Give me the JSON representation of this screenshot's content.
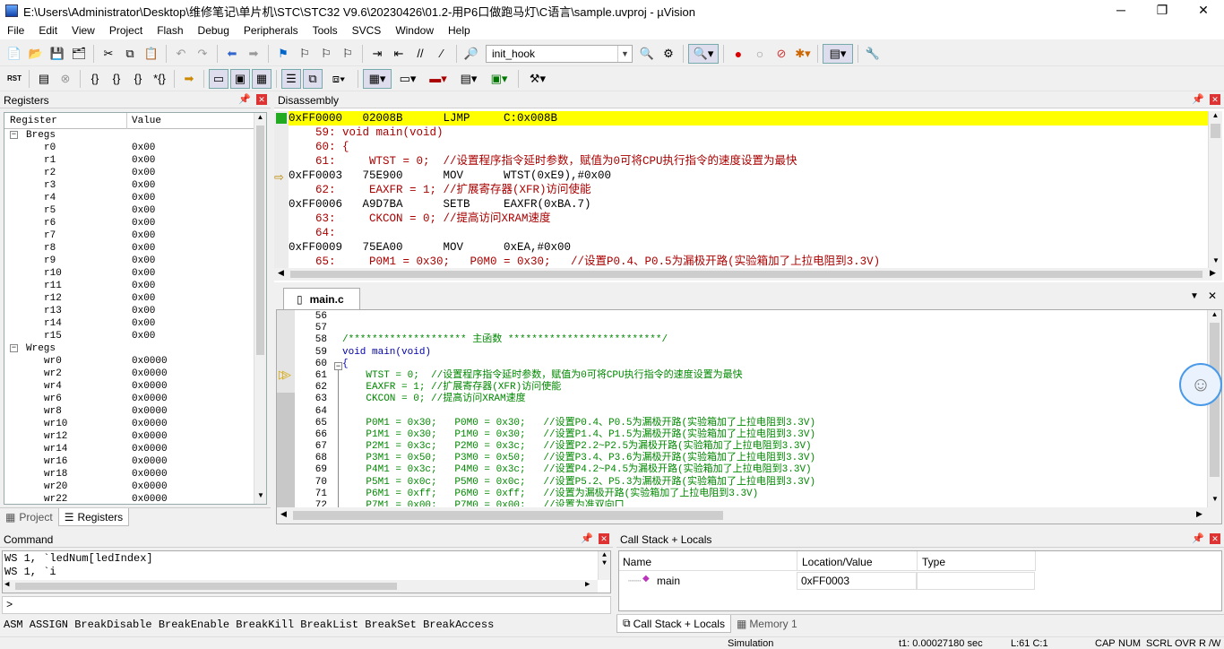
{
  "window": {
    "title": "E:\\Users\\Administrator\\Desktop\\维修笔记\\单片机\\STC\\STC32 V9.6\\20230426\\01.2-用P6口做跑马灯\\C语言\\sample.uvproj - µVision",
    "minimize": "─",
    "maximize": "❐",
    "close": "✕"
  },
  "menu": [
    "File",
    "Edit",
    "View",
    "Project",
    "Flash",
    "Debug",
    "Peripherals",
    "Tools",
    "SVCS",
    "Window",
    "Help"
  ],
  "toolbar": {
    "combo_value": "init_hook"
  },
  "registers": {
    "title": "Registers",
    "col_register": "Register",
    "col_value": "Value",
    "groups": [
      {
        "name": "Bregs",
        "items": [
          {
            "n": "r0",
            "v": "0x00"
          },
          {
            "n": "r1",
            "v": "0x00"
          },
          {
            "n": "r2",
            "v": "0x00"
          },
          {
            "n": "r3",
            "v": "0x00"
          },
          {
            "n": "r4",
            "v": "0x00"
          },
          {
            "n": "r5",
            "v": "0x00"
          },
          {
            "n": "r6",
            "v": "0x00"
          },
          {
            "n": "r7",
            "v": "0x00"
          },
          {
            "n": "r8",
            "v": "0x00"
          },
          {
            "n": "r9",
            "v": "0x00"
          },
          {
            "n": "r10",
            "v": "0x00"
          },
          {
            "n": "r11",
            "v": "0x00"
          },
          {
            "n": "r12",
            "v": "0x00"
          },
          {
            "n": "r13",
            "v": "0x00"
          },
          {
            "n": "r14",
            "v": "0x00"
          },
          {
            "n": "r15",
            "v": "0x00"
          }
        ]
      },
      {
        "name": "Wregs",
        "items": [
          {
            "n": "wr0",
            "v": "0x0000"
          },
          {
            "n": "wr2",
            "v": "0x0000"
          },
          {
            "n": "wr4",
            "v": "0x0000"
          },
          {
            "n": "wr6",
            "v": "0x0000"
          },
          {
            "n": "wr8",
            "v": "0x0000"
          },
          {
            "n": "wr10",
            "v": "0x0000"
          },
          {
            "n": "wr12",
            "v": "0x0000"
          },
          {
            "n": "wr14",
            "v": "0x0000"
          },
          {
            "n": "wr16",
            "v": "0x0000"
          },
          {
            "n": "wr18",
            "v": "0x0000"
          },
          {
            "n": "wr20",
            "v": "0x0000"
          },
          {
            "n": "wr22",
            "v": "0x0000"
          }
        ]
      }
    ],
    "tab_project": "Project",
    "tab_registers": "Registers"
  },
  "disassembly": {
    "title": "Disassembly",
    "lines": [
      "0xFF0000   02008B      LJMP     C:0x008B",
      "    59: void main(void)",
      "    60: {",
      "    61:     WTST = 0;  //设置程序指令延时参数，赋值为0可将CPU执行指令的速度设置为最快",
      "0xFF0003   75E900      MOV      WTST(0xE9),#0x00",
      "    62:     EAXFR = 1; //扩展寄存器(XFR)访问使能",
      "0xFF0006   A9D7BA      SETB     EAXFR(0xBA.7)",
      "    63:     CKCON = 0; //提高访问XRAM速度",
      "    64: ",
      "0xFF0009   75EA00      MOV      0xEA,#0x00",
      "    65:     P0M1 = 0x30;   P0M0 = 0x30;   //设置P0.4、P0.5为漏极开路(实验箱加了上拉电阻到3.3V)"
    ]
  },
  "editor": {
    "tab": "main.c",
    "lines": [
      {
        "ln": "56",
        "t": ""
      },
      {
        "ln": "57",
        "t": ""
      },
      {
        "ln": "58",
        "t": "/******************** 主函数 **************************/"
      },
      {
        "ln": "59",
        "t": "void main(void)"
      },
      {
        "ln": "60",
        "t": "{"
      },
      {
        "ln": "61",
        "t": "    WTST = 0;  //设置程序指令延时参数，赋值为0可将CPU执行指令的速度设置为最快"
      },
      {
        "ln": "62",
        "t": "    EAXFR = 1; //扩展寄存器(XFR)访问使能"
      },
      {
        "ln": "63",
        "t": "    CKCON = 0; //提高访问XRAM速度"
      },
      {
        "ln": "64",
        "t": ""
      },
      {
        "ln": "65",
        "t": "    P0M1 = 0x30;   P0M0 = 0x30;   //设置P0.4、P0.5为漏极开路(实验箱加了上拉电阻到3.3V)"
      },
      {
        "ln": "66",
        "t": "    P1M1 = 0x30;   P1M0 = 0x30;   //设置P1.4、P1.5为漏极开路(实验箱加了上拉电阻到3.3V)"
      },
      {
        "ln": "67",
        "t": "    P2M1 = 0x3c;   P2M0 = 0x3c;   //设置P2.2~P2.5为漏极开路(实验箱加了上拉电阻到3.3V)"
      },
      {
        "ln": "68",
        "t": "    P3M1 = 0x50;   P3M0 = 0x50;   //设置P3.4、P3.6为漏极开路(实验箱加了上拉电阻到3.3V)"
      },
      {
        "ln": "69",
        "t": "    P4M1 = 0x3c;   P4M0 = 0x3c;   //设置P4.2~P4.5为漏极开路(实验箱加了上拉电阻到3.3V)"
      },
      {
        "ln": "70",
        "t": "    P5M1 = 0x0c;   P5M0 = 0x0c;   //设置P5.2、P5.3为漏极开路(实验箱加了上拉电阻到3.3V)"
      },
      {
        "ln": "71",
        "t": "    P6M1 = 0xff;   P6M0 = 0xff;   //设置为漏极开路(实验箱加了上拉电阻到3.3V)"
      },
      {
        "ln": "72",
        "t": "    P7M1 = 0x00;   P7M0 = 0x00;   //设置为准双向口"
      }
    ]
  },
  "command": {
    "title": "Command",
    "lines": [
      "WS 1, `ledNum[ledIndex]",
      "WS 1, `i"
    ],
    "prompt": ">",
    "hints": "ASM ASSIGN BreakDisable BreakEnable BreakKill BreakList BreakSet BreakAccess"
  },
  "callstack": {
    "title": "Call Stack + Locals",
    "col_name": "Name",
    "col_location": "Location/Value",
    "col_type": "Type",
    "rows": [
      {
        "name": "main",
        "location": "0xFF0003",
        "type": ""
      }
    ],
    "tab_callstack": "Call Stack + Locals",
    "tab_memory": "Memory 1"
  },
  "status": {
    "mode": "Simulation",
    "time": "t1: 0.00027180 sec",
    "pos": "L:61 C:1",
    "caps": "CAP",
    "num": "NUM",
    "scrl": "SCRL",
    "ovr": "OVR",
    "rw": "R /W"
  }
}
